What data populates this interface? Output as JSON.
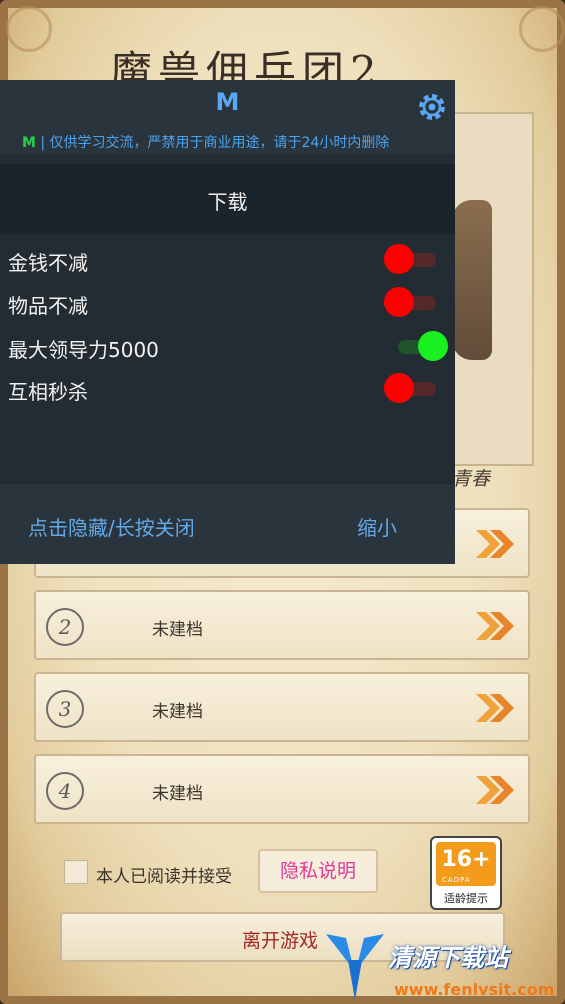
{
  "game": {
    "title": "魔兽佣兵团2",
    "hero_caption": "青春",
    "slots": [
      {
        "number": "2",
        "label": "未建档"
      },
      {
        "number": "3",
        "label": "未建档"
      },
      {
        "number": "4",
        "label": "未建档"
      }
    ],
    "agree_text": "本人已阅读并接受",
    "privacy_label": "隐私说明",
    "age_rating": "16+",
    "age_org": "CADPA",
    "age_tip": "适龄提示",
    "leave_label": "离开游戏"
  },
  "mod_menu": {
    "logo": "M",
    "notice_prefix": "M",
    "notice_text": " | 仅供学习交流，严禁用于商业用途，请于24小时内删除",
    "tab": "下载",
    "options": [
      {
        "label": "金钱不减",
        "enabled": false
      },
      {
        "label": "物品不减",
        "enabled": false
      },
      {
        "label": "最大领导力5000",
        "enabled": true
      },
      {
        "label": "互相秒杀",
        "enabled": false
      }
    ],
    "footer_hide": "点击隐藏/长按关闭",
    "footer_minimize": "缩小",
    "colors": {
      "accent": "#5aa8f5",
      "on": "#1af020",
      "off": "#fe0000"
    }
  },
  "watermark": {
    "name": "清源下载站",
    "url": "www.fenlvsit.com"
  }
}
